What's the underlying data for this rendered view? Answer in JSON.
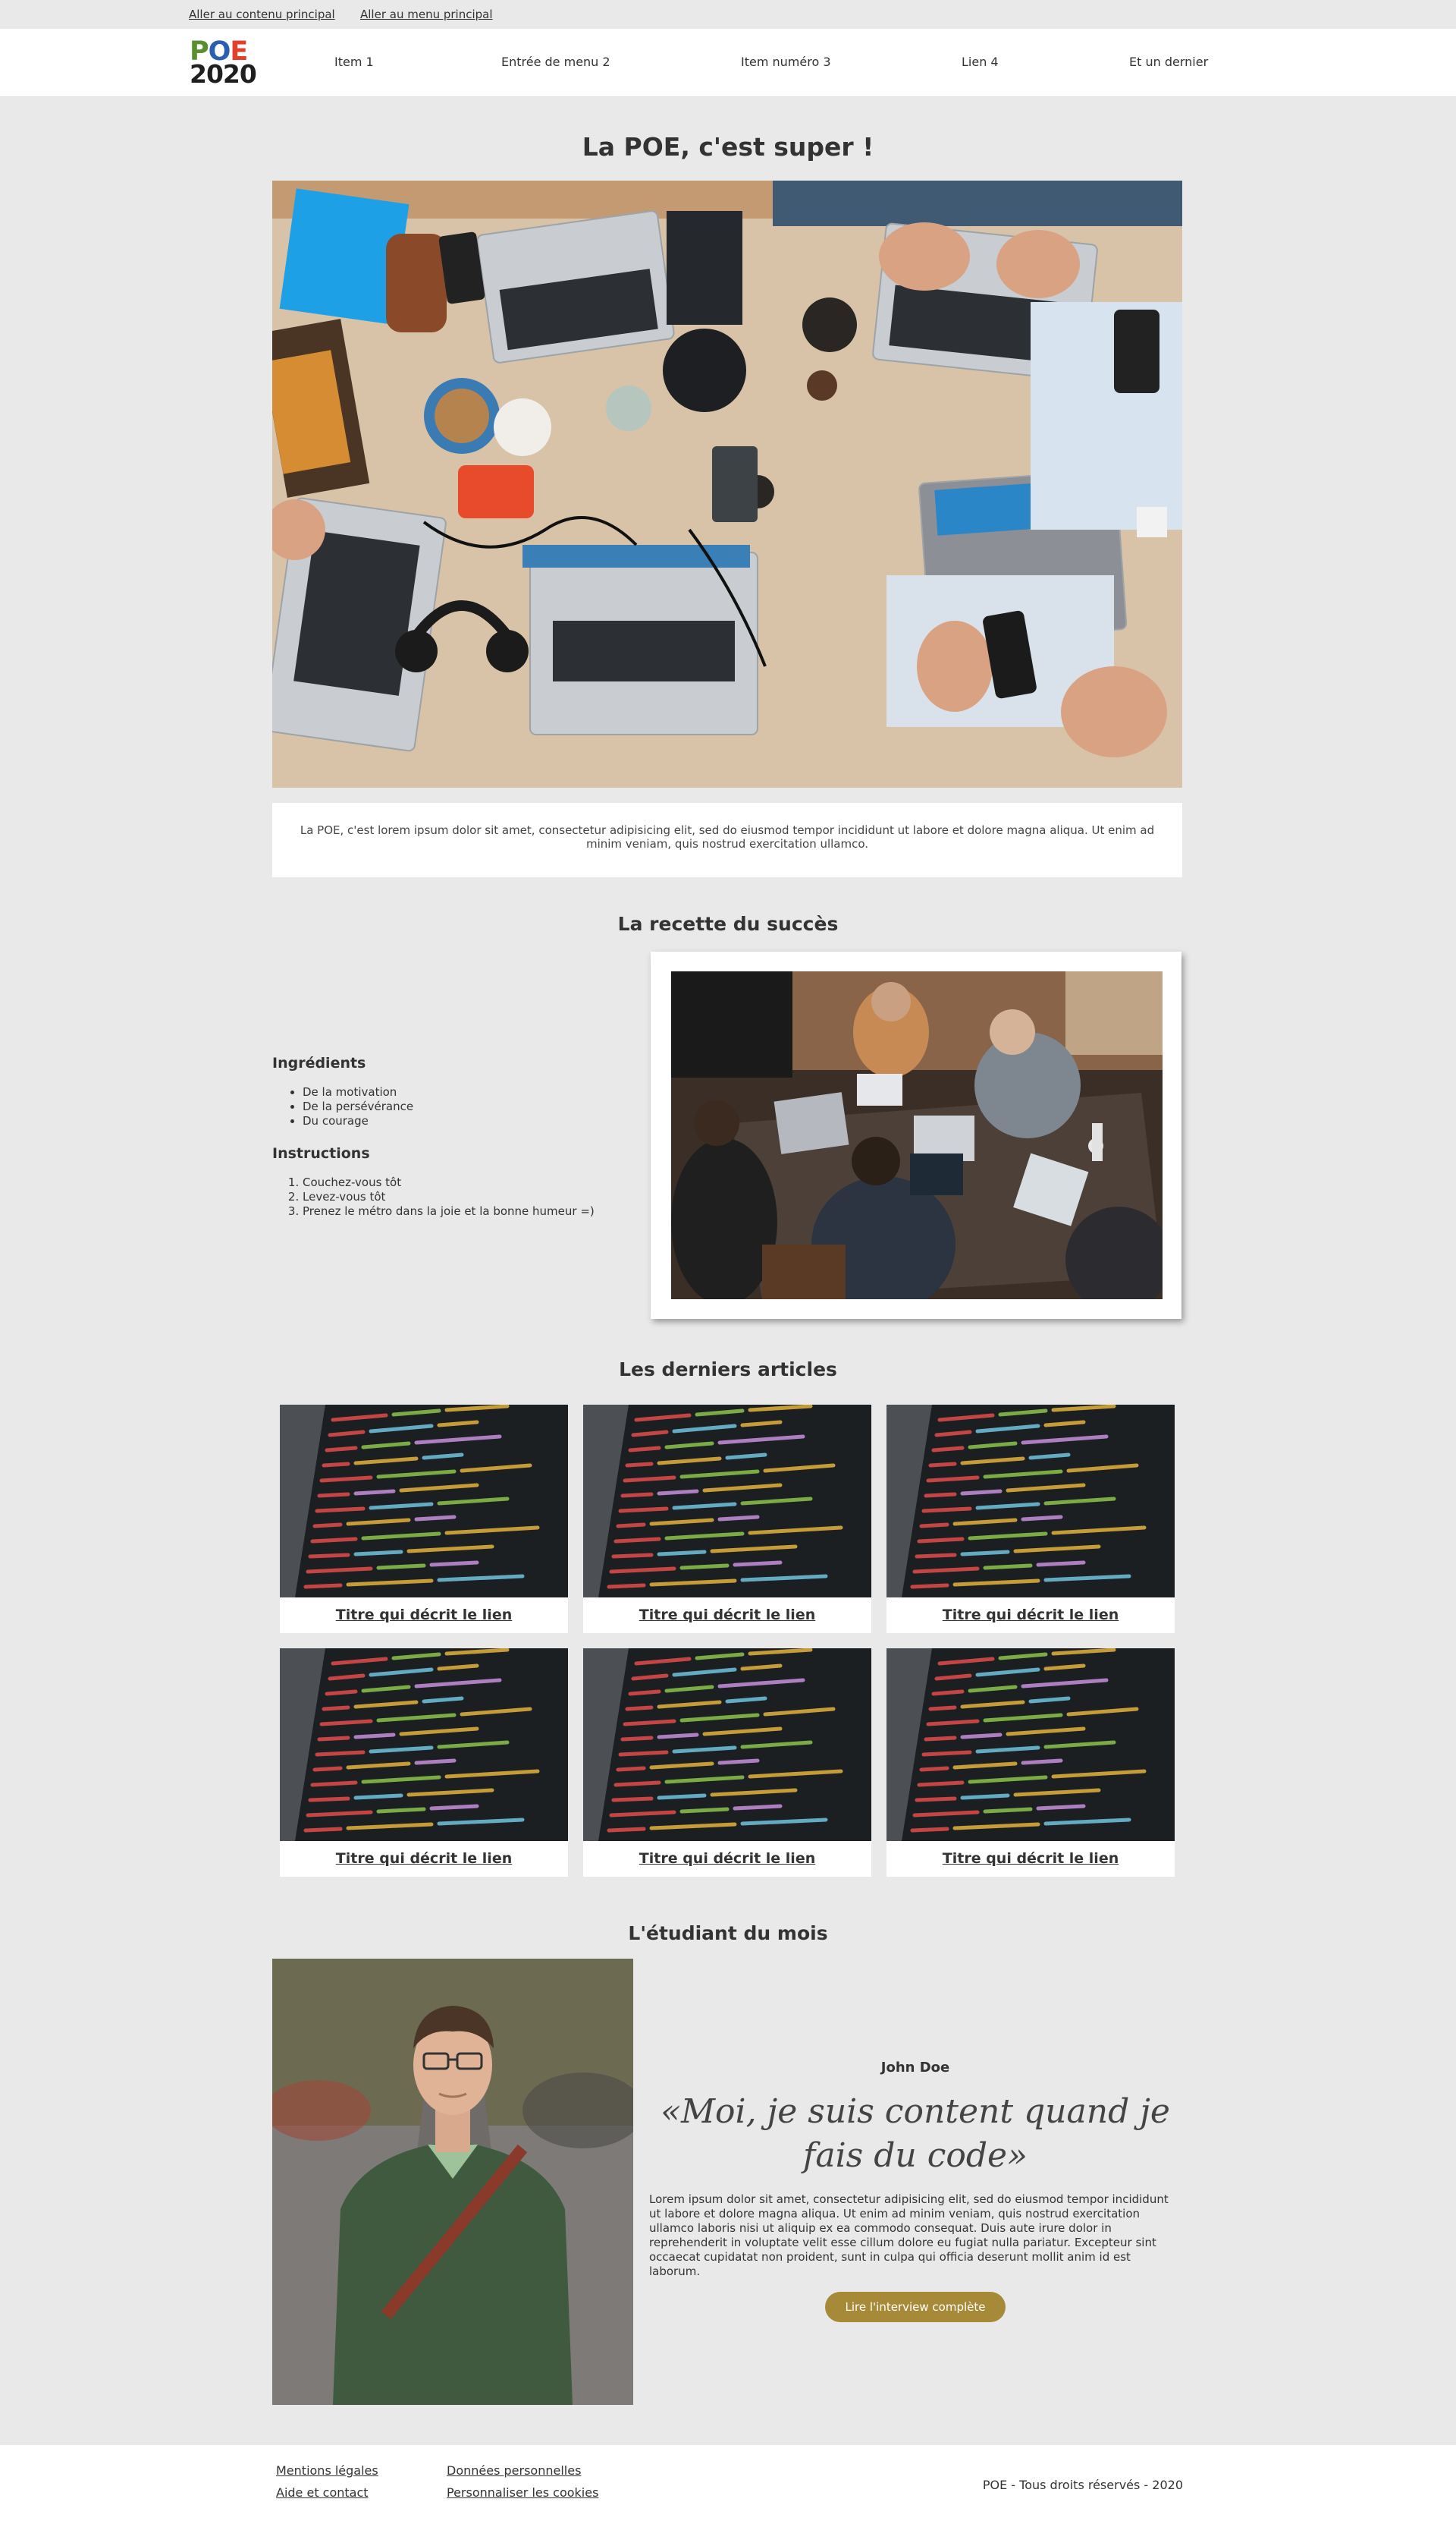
{
  "skip_links": {
    "content": "Aller au contenu principal",
    "menu": "Aller au menu principal"
  },
  "logo": {
    "line1": [
      "P",
      "O",
      "E"
    ],
    "line2": "2020"
  },
  "nav": {
    "items": [
      "Item 1",
      "Entrée de menu 2",
      "Item numéro 3",
      "Lien 4",
      "Et un dernier"
    ]
  },
  "hero": {
    "title": "La POE, c'est super !",
    "caption": "La POE, c'est lorem ipsum dolor sit amet, consectetur adipisicing elit, sed do eiusmod tempor incididunt ut labore et dolore magna aliqua. Ut enim ad minim veniam, quis nostrud exercitation ullamco."
  },
  "recipe": {
    "title": "La recette du succès",
    "ingredients_title": "Ingrédients",
    "ingredients": [
      "De la motivation",
      "De la persévérance",
      "Du courage"
    ],
    "instructions_title": "Instructions",
    "instructions": [
      "Couchez-vous tôt",
      "Levez-vous tôt",
      "Prenez le métro dans la joie et la bonne humeur =)"
    ]
  },
  "articles": {
    "title": "Les derniers articles",
    "items": [
      {
        "label": "Titre qui décrit le lien"
      },
      {
        "label": "Titre qui décrit le lien"
      },
      {
        "label": "Titre qui décrit le lien"
      },
      {
        "label": "Titre qui décrit le lien"
      },
      {
        "label": "Titre qui décrit le lien"
      },
      {
        "label": "Titre qui décrit le lien"
      }
    ]
  },
  "student": {
    "title": "L'étudiant du mois",
    "name": "John Doe",
    "quote": "«Moi, je suis content quand je fais du code»",
    "text": "Lorem ipsum dolor sit amet, consectetur adipisicing elit, sed do eiusmod tempor incididunt ut labore et dolore magna aliqua. Ut enim ad minim veniam, quis nostrud exercitation ullamco laboris nisi ut aliquip ex ea commodo consequat. Duis aute irure dolor in reprehenderit in voluptate velit esse cillum dolore eu fugiat nulla pariatur. Excepteur sint occaecat cupidatat non proident, sunt in culpa qui officia deserunt mollit anim id est laborum.",
    "button": "Lire l'interview complète"
  },
  "footer": {
    "legal": "Mentions légales",
    "help": "Aide et contact",
    "privacy": "Données personnelles",
    "cookies": "Personnaliser les cookies",
    "copyright": "POE - Tous droits réservés - 2020"
  },
  "colors": {
    "background": "#e9e9e9",
    "button": "#a78a38",
    "logo_green": "#5a8f2e",
    "logo_blue": "#2b5fb0",
    "logo_red": "#e2402b"
  }
}
